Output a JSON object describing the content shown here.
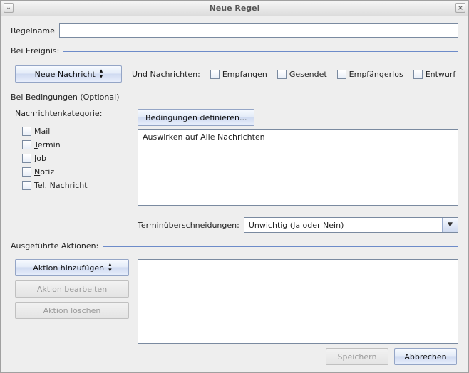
{
  "window": {
    "title": "Neue Regel"
  },
  "rulename": {
    "label": "Regelname",
    "value": ""
  },
  "event": {
    "header": "Bei Ereignis:",
    "button": "Neue Nachricht",
    "and_label": "Und Nachrichten:",
    "checks": {
      "received": "Empfangen",
      "sent": "Gesendet",
      "recipientless": "Empfängerlos",
      "draft": "Entwurf"
    }
  },
  "conditions": {
    "header": "Bei Bedingungen  (Optional)",
    "category_label": "Nachrichtenkategorie:",
    "categories": {
      "mail": "ail",
      "termin": "ermin",
      "job": "ob",
      "notiz": "otiz",
      "tel": "el. Nachricht"
    },
    "define_button": "Bedingungen definieren...",
    "summary": "Auswirken auf Alle Nachrichten",
    "overlap_label": "Terminüberschneidungen:",
    "overlap_value": "Unwichtig (Ja oder Nein)"
  },
  "actions": {
    "header": "Ausgeführte Aktionen:",
    "add": "Aktion hinzufügen",
    "edit": "Aktion bearbeiten",
    "delete": "Aktion löschen"
  },
  "footer": {
    "save": "Speichern",
    "cancel": "Abbrechen"
  }
}
